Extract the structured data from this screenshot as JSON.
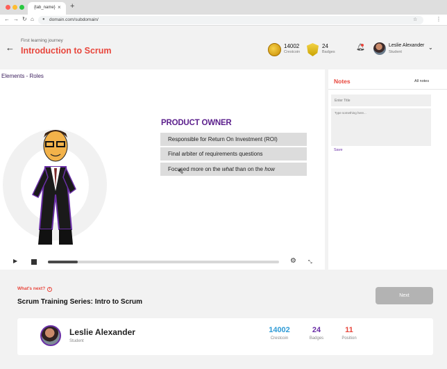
{
  "browser": {
    "tab_title": "{tab_name}",
    "url": "domain.com/subdomain/"
  },
  "header": {
    "journey_label": "First learning journey",
    "course_title": "Introduction to Scrum",
    "crestcoin_value": "14002",
    "crestcoin_label": "Crestcoin",
    "badges_value": "24",
    "badges_label": "Badges",
    "user_name": "Leslie Alexander",
    "user_role": "Student"
  },
  "video": {
    "section_title": "Elements - Roles",
    "slide_heading": "PRODUCT OWNER",
    "slide_items": [
      "Responsible for Return On Investment (ROI)",
      "Final arbiter of requirements questions"
    ],
    "slide_item_3_prefix": "Focused more on the ",
    "slide_item_3_em1": "what",
    "slide_item_3_mid": " than on the ",
    "slide_item_3_em2": "how",
    "progress_fraction": 0.13
  },
  "notes": {
    "title": "Notes",
    "all_notes": "All notes",
    "title_placeholder": "Enter Title",
    "body_placeholder": "Type something here...",
    "save_label": "Save"
  },
  "next": {
    "label": "What's next?",
    "course_title": "Scrum Training Series: Intro to Scrum",
    "button_label": "Next"
  },
  "profile": {
    "name": "Leslie Alexander",
    "role": "Student",
    "stats": [
      {
        "value": "14002",
        "label": "Crestcoin"
      },
      {
        "value": "24",
        "label": "Badges"
      },
      {
        "value": "11",
        "label": "Position"
      }
    ]
  },
  "colors": {
    "accent_red": "#e8463c",
    "accent_purple": "#6a2fa6",
    "accent_blue": "#2f9bd6"
  }
}
